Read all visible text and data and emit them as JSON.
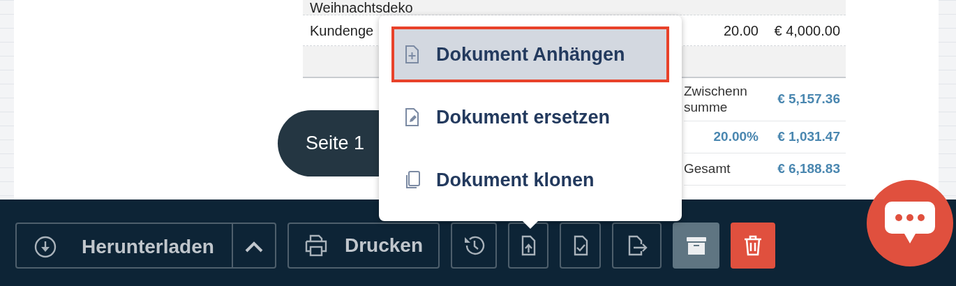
{
  "document": {
    "line_items": [
      {
        "description": "Weihnachtsdeko"
      },
      {
        "description": "Kundenge",
        "price": "20.00",
        "total": "€ 4,000.00"
      }
    ],
    "totals": [
      {
        "label": "Zwischenn summe",
        "amount": "€ 5,157.36"
      },
      {
        "rate": "20.00%",
        "amount": "€ 1,031.47"
      },
      {
        "label": "Gesamt",
        "amount": "€ 6,188.83"
      }
    ],
    "page_indicator": "Seite 1"
  },
  "menu": {
    "items": [
      {
        "label": "Dokument Anhängen",
        "selected": true
      },
      {
        "label": "Dokument ersetzen",
        "selected": false
      },
      {
        "label": "Dokument klonen",
        "selected": false
      }
    ]
  },
  "toolbar": {
    "download_button": "Herunterladen",
    "print_button": "Drucken"
  }
}
